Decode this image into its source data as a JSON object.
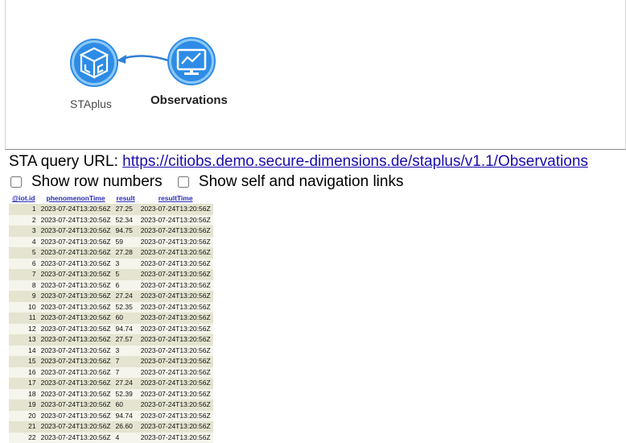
{
  "graph": {
    "nodes": [
      {
        "label": "STAplus",
        "icon": "staplus-cube-icon"
      },
      {
        "label": "Observations",
        "icon": "monitor-chart-icon"
      }
    ],
    "colors": {
      "node_fill": "#2e8ce6",
      "node_light": "#8cc8f6",
      "arrow": "#2f7fd6"
    }
  },
  "query": {
    "prefix": "STA query URL: ",
    "url": "https://citiobs.demo.secure-dimensions.de/staplus/v1.1/Observations"
  },
  "options": {
    "show_row_numbers": "Show row numbers",
    "show_links": "Show self and navigation links"
  },
  "table": {
    "headers": [
      "@iot.id",
      "phenomenonTime",
      "result",
      "resultTime"
    ],
    "rows": [
      [
        "1",
        "2023-07-24T13:20:56Z",
        "27.25",
        "2023-07-24T13:20:56Z"
      ],
      [
        "2",
        "2023-07-24T13:20:56Z",
        "52.34",
        "2023-07-24T13:20:56Z"
      ],
      [
        "3",
        "2023-07-24T13:20:56Z",
        "94.75",
        "2023-07-24T13:20:56Z"
      ],
      [
        "4",
        "2023-07-24T13:20:56Z",
        "59",
        "2023-07-24T13:20:56Z"
      ],
      [
        "5",
        "2023-07-24T13:20:56Z",
        "27.28",
        "2023-07-24T13:20:56Z"
      ],
      [
        "6",
        "2023-07-24T13:20:56Z",
        "3",
        "2023-07-24T13:20:56Z"
      ],
      [
        "7",
        "2023-07-24T13:20:56Z",
        "5",
        "2023-07-24T13:20:56Z"
      ],
      [
        "8",
        "2023-07-24T13:20:56Z",
        "6",
        "2023-07-24T13:20:56Z"
      ],
      [
        "9",
        "2023-07-24T13:20:56Z",
        "27.24",
        "2023-07-24T13:20:56Z"
      ],
      [
        "10",
        "2023-07-24T13:20:56Z",
        "52.35",
        "2023-07-24T13:20:56Z"
      ],
      [
        "11",
        "2023-07-24T13:20:56Z",
        "60",
        "2023-07-24T13:20:56Z"
      ],
      [
        "12",
        "2023-07-24T13:20:56Z",
        "94.74",
        "2023-07-24T13:20:56Z"
      ],
      [
        "13",
        "2023-07-24T13:20:56Z",
        "27.57",
        "2023-07-24T13:20:56Z"
      ],
      [
        "14",
        "2023-07-24T13:20:56Z",
        "3",
        "2023-07-24T13:20:56Z"
      ],
      [
        "15",
        "2023-07-24T13:20:56Z",
        "7",
        "2023-07-24T13:20:56Z"
      ],
      [
        "16",
        "2023-07-24T13:20:56Z",
        "7",
        "2023-07-24T13:20:56Z"
      ],
      [
        "17",
        "2023-07-24T13:20:56Z",
        "27.24",
        "2023-07-24T13:20:56Z"
      ],
      [
        "18",
        "2023-07-24T13:20:56Z",
        "52.39",
        "2023-07-24T13:20:56Z"
      ],
      [
        "19",
        "2023-07-24T13:20:56Z",
        "60",
        "2023-07-24T13:20:56Z"
      ],
      [
        "20",
        "2023-07-24T13:20:56Z",
        "94.74",
        "2023-07-24T13:20:56Z"
      ],
      [
        "21",
        "2023-07-24T13:20:56Z",
        "26.60",
        "2023-07-24T13:20:56Z"
      ],
      [
        "22",
        "2023-07-24T13:20:56Z",
        "4",
        "2023-07-24T13:20:56Z"
      ]
    ]
  }
}
